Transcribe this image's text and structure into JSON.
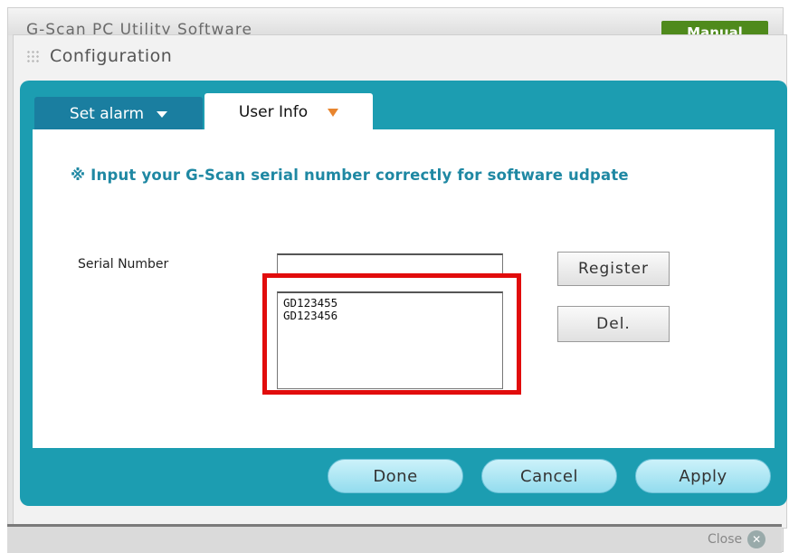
{
  "app": {
    "title": "G-Scan PC Utility Software",
    "manual_label": "Manual"
  },
  "dialog": {
    "title": "Configuration",
    "tabs": [
      {
        "label": "Set alarm",
        "active": false
      },
      {
        "label": "User Info",
        "active": true
      }
    ],
    "notice": "※ Input your G-Scan serial number correctly for software udpate",
    "serial": {
      "label": "Serial Number",
      "input_value": "",
      "entries": [
        "GD123455",
        "GD123456"
      ]
    },
    "buttons": {
      "register": "Register",
      "delete": "Del.",
      "done": "Done",
      "cancel": "Cancel",
      "apply": "Apply"
    },
    "close_label": "Close"
  },
  "colors": {
    "panel": "#1c9db1",
    "active_tab_arrow": "#e8852f",
    "highlight": "#e10c0c",
    "notice_text": "#1f88a3",
    "manual_button": "#4f8a1c"
  },
  "icons": {
    "close": "close-circle-icon",
    "tab_dropdown": "triangle-down-icon",
    "grip": "grip-dots-icon"
  }
}
